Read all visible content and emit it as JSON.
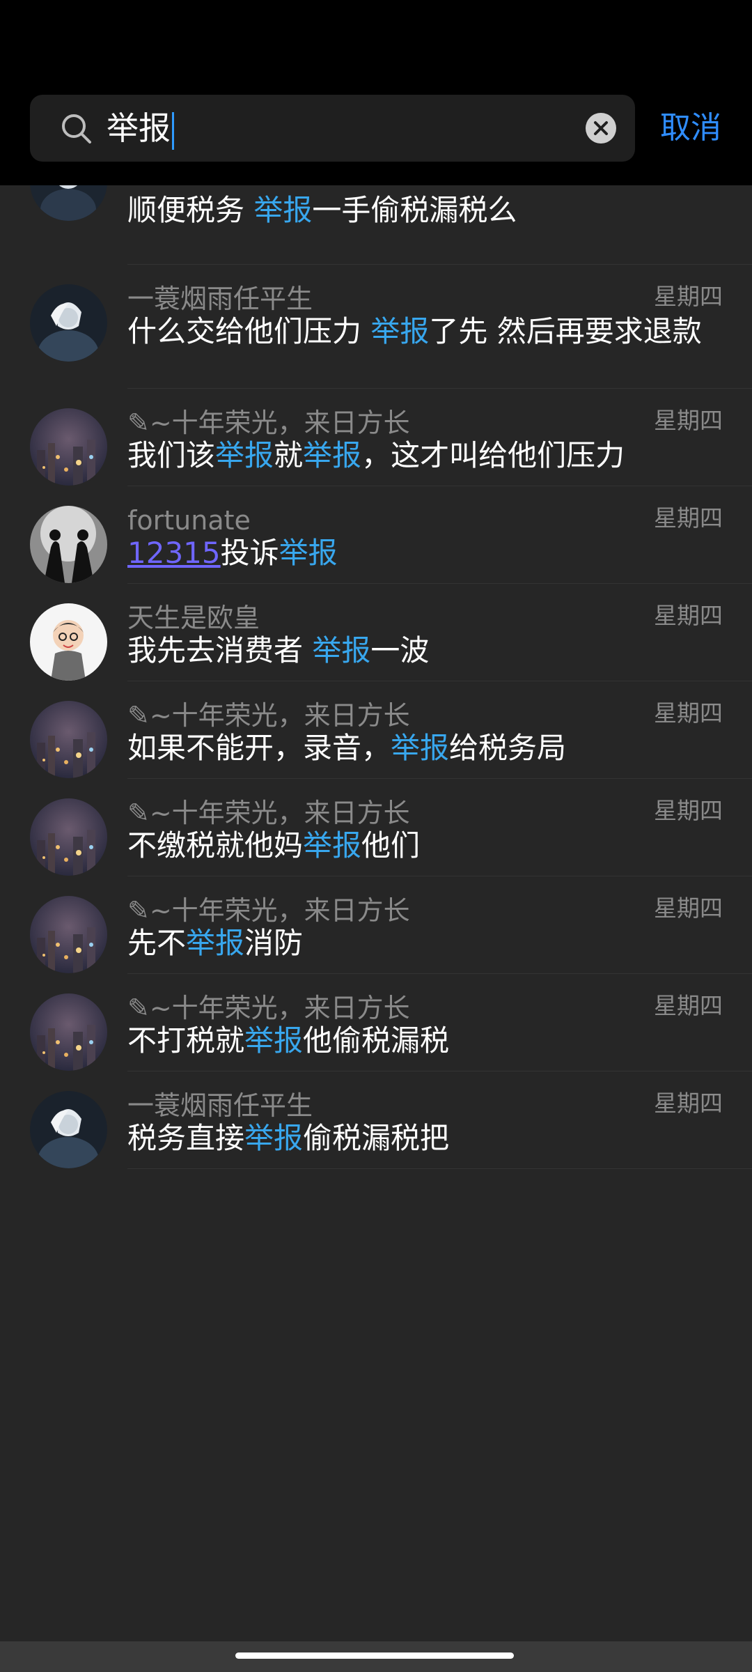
{
  "search": {
    "query": "举报"
  },
  "header": {
    "cancel_label": "取消"
  },
  "colors": {
    "highlight": "#38a7ee",
    "link": "#6f66ff",
    "accent": "#2f8dff"
  },
  "partial_result": {
    "avatar_icon": "avatar-photo-dark-figure",
    "message": {
      "pre": "顺便税务 ",
      "hl": "举报",
      "post": "一手偷税漏税么"
    }
  },
  "results": [
    {
      "avatar": "dark-figure",
      "name": "一蓑烟雨任平生",
      "date": "星期四",
      "parts": [
        [
          "什么交给他们压力 ",
          ""
        ],
        [
          "举报",
          "hl"
        ],
        [
          "了先 然后再要求退款",
          ""
        ]
      ]
    },
    {
      "avatar": "city-night",
      "name": "✎~十年荣光，来日方长",
      "date": "星期四",
      "parts": [
        [
          "我们该",
          ""
        ],
        [
          "举报",
          "hl"
        ],
        [
          "就",
          ""
        ],
        [
          "举报",
          "hl"
        ],
        [
          "，这才叫给他们压力",
          ""
        ]
      ]
    },
    {
      "avatar": "two-silhouettes",
      "name": "fortunate",
      "date": "星期四",
      "parts": [
        [
          "12315",
          "link"
        ],
        [
          "投诉",
          ""
        ],
        [
          "举报",
          "hl"
        ]
      ]
    },
    {
      "avatar": "cartoon-boy",
      "name": "天生是欧皇",
      "date": "星期四",
      "parts": [
        [
          "我先去消费者 ",
          ""
        ],
        [
          "举报",
          "hl"
        ],
        [
          "一波",
          ""
        ]
      ]
    },
    {
      "avatar": "city-night",
      "name": "✎~十年荣光，来日方长",
      "date": "星期四",
      "parts": [
        [
          "如果不能开，录音，",
          ""
        ],
        [
          "举报",
          "hl"
        ],
        [
          "给税务局",
          ""
        ]
      ]
    },
    {
      "avatar": "city-night",
      "name": "✎~十年荣光，来日方长",
      "date": "星期四",
      "parts": [
        [
          "不缴税就他妈",
          ""
        ],
        [
          "举报",
          "hl"
        ],
        [
          "他们",
          ""
        ]
      ]
    },
    {
      "avatar": "city-night",
      "name": "✎~十年荣光，来日方长",
      "date": "星期四",
      "parts": [
        [
          "先不",
          ""
        ],
        [
          "举报",
          "hl"
        ],
        [
          "消防",
          ""
        ]
      ]
    },
    {
      "avatar": "city-night",
      "name": "✎~十年荣光，来日方长",
      "date": "星期四",
      "parts": [
        [
          "不打税就",
          ""
        ],
        [
          "举报",
          "hl"
        ],
        [
          "他偷税漏税",
          ""
        ]
      ]
    },
    {
      "avatar": "dark-figure",
      "name": "一蓑烟雨任平生",
      "date": "星期四",
      "parts": [
        [
          "税务直接",
          ""
        ],
        [
          "举报",
          "hl"
        ],
        [
          "偷税漏税把",
          ""
        ]
      ]
    }
  ]
}
